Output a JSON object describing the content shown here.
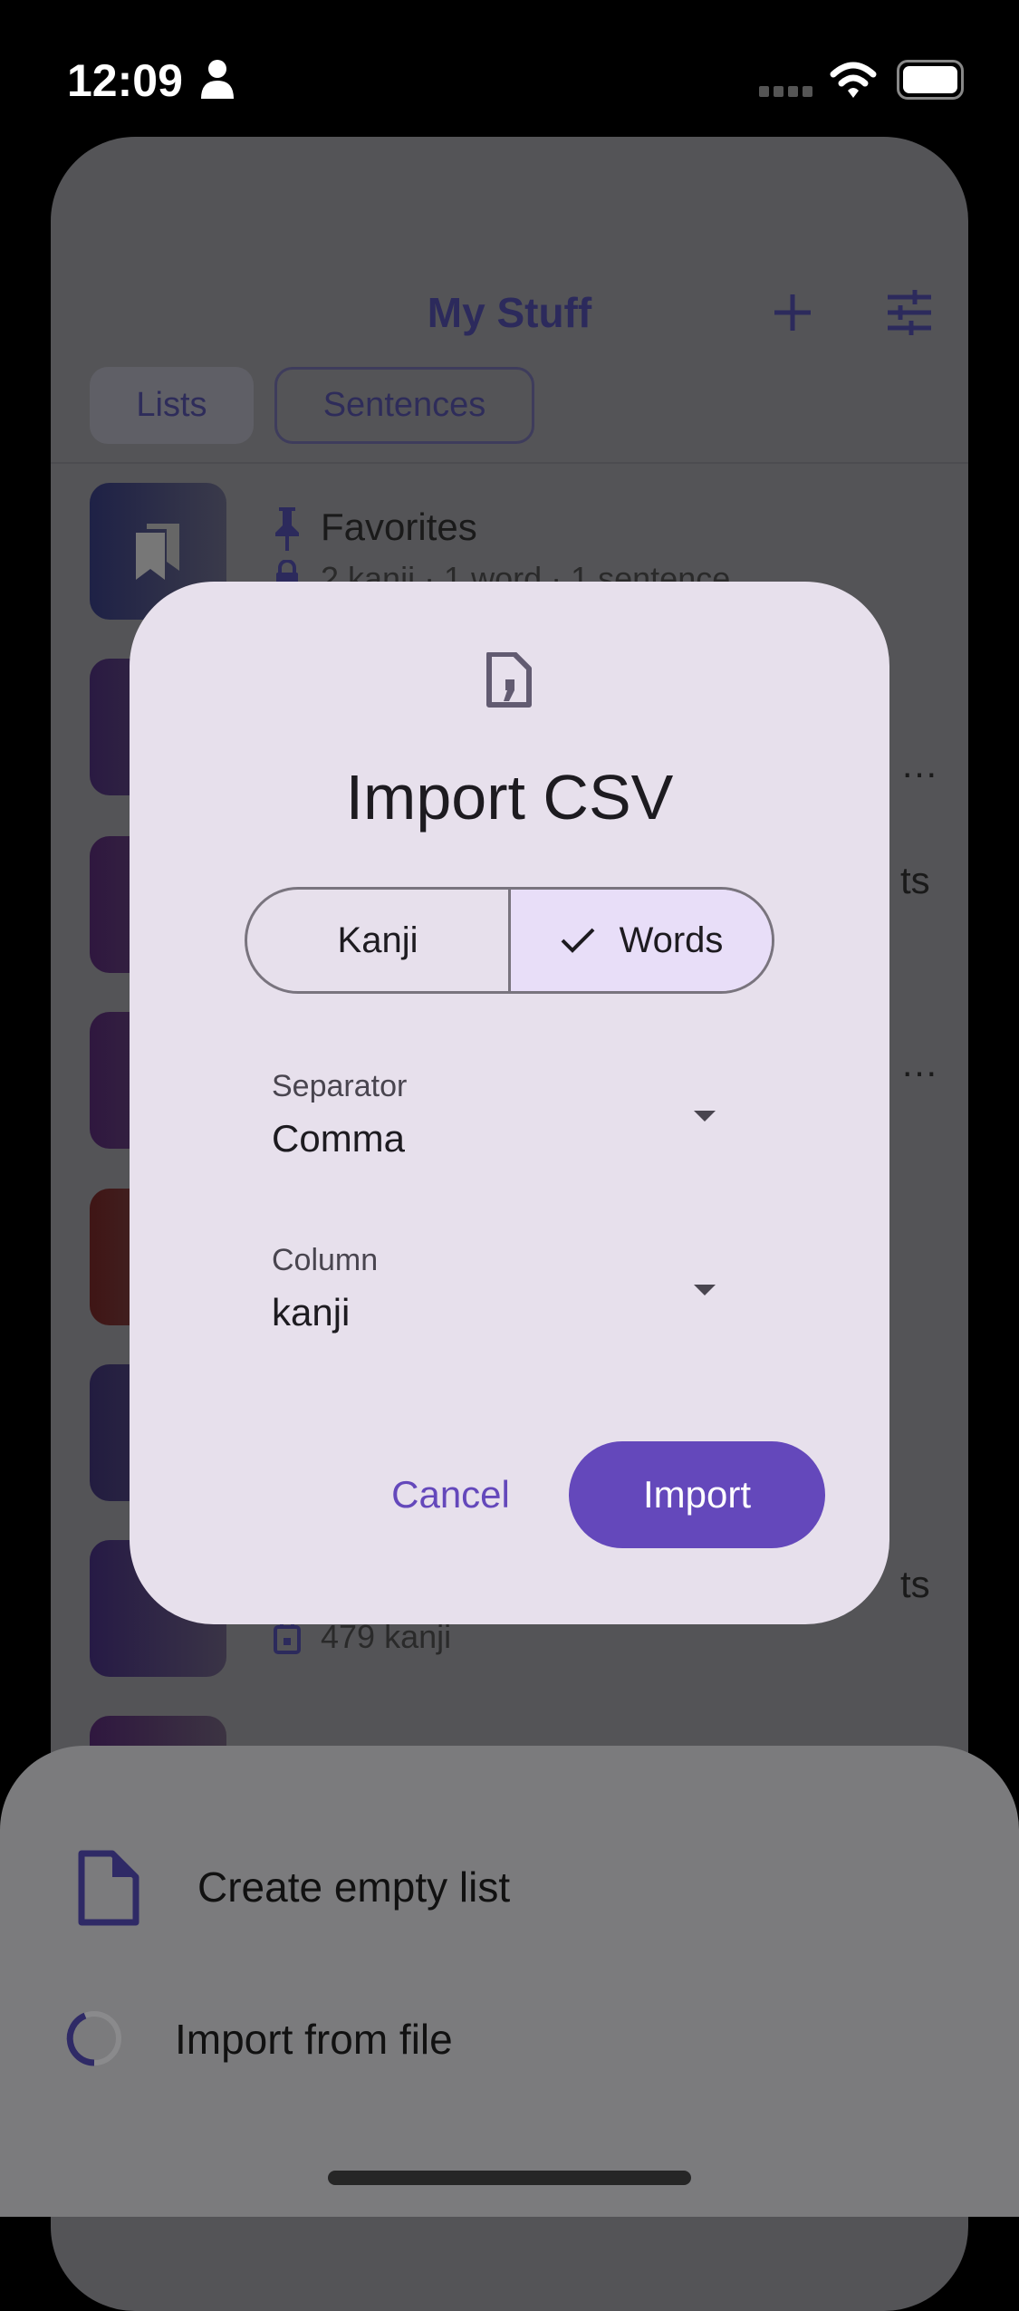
{
  "status_bar": {
    "time": "12:09",
    "icons": [
      "person-icon",
      "signal-dots-icon",
      "wifi-icon",
      "battery-icon"
    ]
  },
  "header": {
    "title": "My Stuff",
    "actions": [
      "plus-icon",
      "sliders-icon"
    ]
  },
  "tabs": [
    {
      "label": "Lists",
      "selected": true
    },
    {
      "label": "Sentences",
      "selected": false
    }
  ],
  "list": {
    "items": [
      {
        "name": "Favorites",
        "subtitle": "2 kanji · 1 word · 1 sentence",
        "color": "#1e2146"
      },
      {
        "partial": "…",
        "color": "#2a1a42"
      },
      {
        "partial": "ts",
        "color": "#2f173f"
      },
      {
        "partial": "…",
        "color": "#2f173f"
      },
      {
        "partial": "",
        "color": "#3f1515"
      },
      {
        "partial": "",
        "color": "#221c40"
      },
      {
        "partial": "ts",
        "subtitle": "479 kanji",
        "color": "#261a45"
      },
      {
        "partial": "",
        "color": "#2f173f"
      }
    ]
  },
  "dialog": {
    "icon": "csv-file-icon",
    "title": "Import CSV",
    "segments": [
      {
        "label": "Kanji",
        "selected": false
      },
      {
        "label": "Words",
        "selected": true
      }
    ],
    "separator": {
      "label": "Separator",
      "value": "Comma"
    },
    "column": {
      "label": "Column",
      "value": "kanji"
    },
    "cancel": "Cancel",
    "import": "Import",
    "accent": "#6448bb"
  },
  "sheet": {
    "items": [
      {
        "label": "Create empty list",
        "icon": "file-icon"
      },
      {
        "label": "Import from file",
        "icon": "loading-spinner-icon"
      }
    ]
  }
}
